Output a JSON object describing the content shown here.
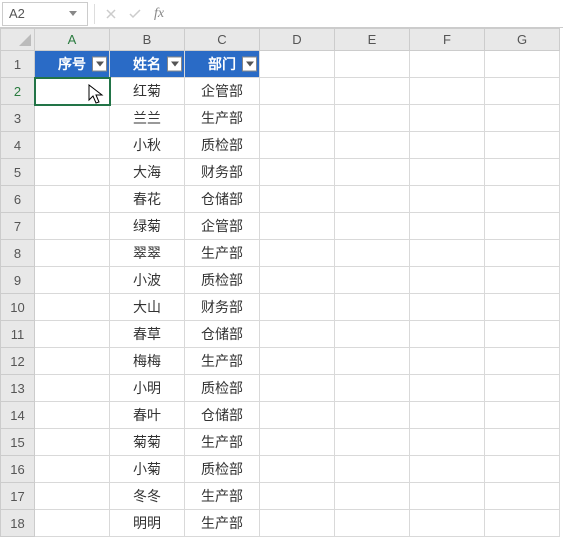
{
  "nameBox": {
    "value": "A2"
  },
  "formulaBar": {
    "fxLabel": "fx",
    "value": ""
  },
  "columns": [
    "A",
    "B",
    "C",
    "D",
    "E",
    "F",
    "G"
  ],
  "activeCol": "A",
  "activeRow": 2,
  "headerRow": {
    "a": "序号",
    "b": "姓名",
    "c": "部门"
  },
  "rows": [
    {
      "n": 1,
      "a": "",
      "b": "",
      "c": ""
    },
    {
      "n": 2,
      "a": "",
      "b": "红菊",
      "c": "企管部"
    },
    {
      "n": 3,
      "a": "",
      "b": "兰兰",
      "c": "生产部"
    },
    {
      "n": 4,
      "a": "",
      "b": "小秋",
      "c": "质检部"
    },
    {
      "n": 5,
      "a": "",
      "b": "大海",
      "c": "财务部"
    },
    {
      "n": 6,
      "a": "",
      "b": "春花",
      "c": "仓储部"
    },
    {
      "n": 7,
      "a": "",
      "b": "绿菊",
      "c": "企管部"
    },
    {
      "n": 8,
      "a": "",
      "b": "翠翠",
      "c": "生产部"
    },
    {
      "n": 9,
      "a": "",
      "b": "小波",
      "c": "质检部"
    },
    {
      "n": 10,
      "a": "",
      "b": "大山",
      "c": "财务部"
    },
    {
      "n": 11,
      "a": "",
      "b": "春草",
      "c": "仓储部"
    },
    {
      "n": 12,
      "a": "",
      "b": "梅梅",
      "c": "生产部"
    },
    {
      "n": 13,
      "a": "",
      "b": "小明",
      "c": "质检部"
    },
    {
      "n": 14,
      "a": "",
      "b": "春叶",
      "c": "仓储部"
    },
    {
      "n": 15,
      "a": "",
      "b": "菊菊",
      "c": "生产部"
    },
    {
      "n": 16,
      "a": "",
      "b": "小菊",
      "c": "质检部"
    },
    {
      "n": 17,
      "a": "",
      "b": "冬冬",
      "c": "生产部"
    },
    {
      "n": 18,
      "a": "",
      "b": "明明",
      "c": "生产部"
    }
  ]
}
